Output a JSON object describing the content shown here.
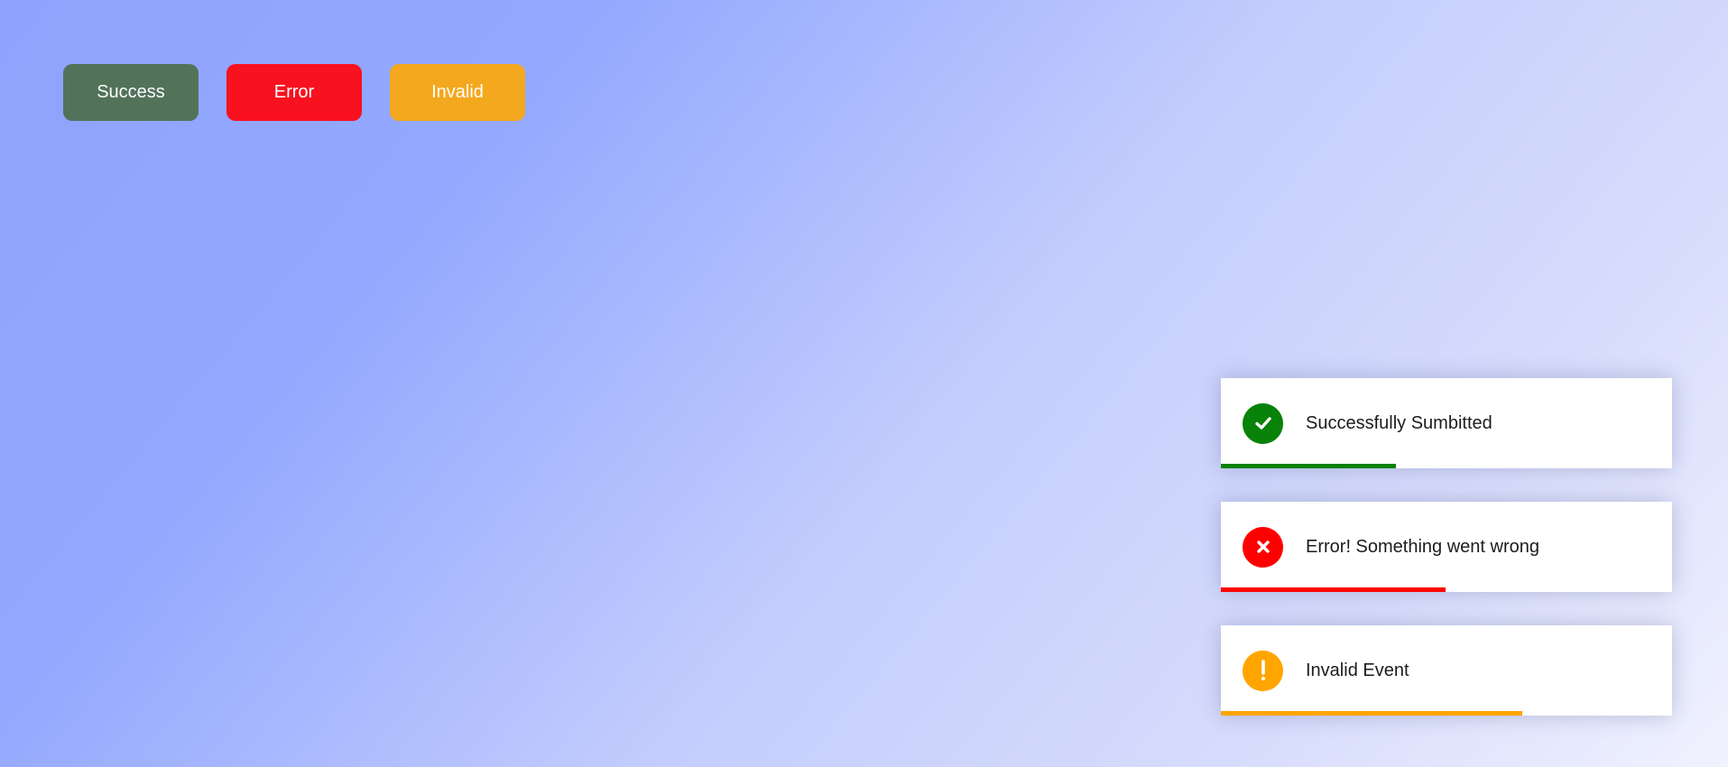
{
  "buttons": [
    {
      "label": "Success",
      "color": "#52735a"
    },
    {
      "label": "Error",
      "color": "#f8111e"
    },
    {
      "label": "Invalid",
      "color": "#f3a81d"
    }
  ],
  "toasts": [
    {
      "icon": "check-icon",
      "message": "Successfully Sumbitted",
      "color": "#088208",
      "progress": 0.387
    },
    {
      "icon": "x-icon",
      "message": "Error! Something went wrong",
      "color": "#ff0000",
      "progress": 0.497
    },
    {
      "icon": "exclamation-icon",
      "message": "Invalid Event",
      "color": "#ffa500",
      "progress": 0.668
    }
  ]
}
